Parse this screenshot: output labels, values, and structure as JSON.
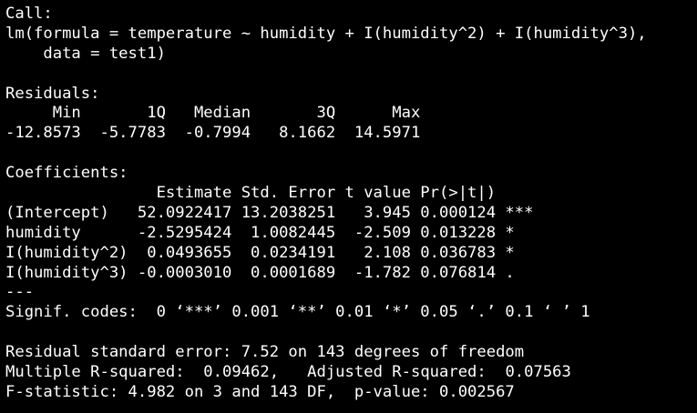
{
  "theme": {
    "background": "#000000",
    "foreground": "#ffffff"
  },
  "output": {
    "lines": [
      "Call:",
      "lm(formula = temperature ~ humidity + I(humidity^2) + I(humidity^3),",
      "    data = test1)",
      "",
      "Residuals:",
      "     Min       1Q   Median       3Q      Max ",
      "-12.8573  -5.7783  -0.7994   8.1662  14.5971 ",
      "",
      "Coefficients:",
      "                Estimate Std. Error t value Pr(>|t|)    ",
      "(Intercept)   52.0922417 13.2038251   3.945 0.000124 ***",
      "humidity      -2.5295424  1.0082445  -2.509 0.013228 *  ",
      "I(humidity^2)  0.0493655  0.0234191   2.108 0.036783 *  ",
      "I(humidity^3) -0.0003010  0.0001689  -1.782 0.076814 .  ",
      "---",
      "Signif. codes:  0 ‘***’ 0.001 ‘**’ 0.01 ‘*’ 0.05 ‘.’ 0.1 ‘ ’ 1",
      "",
      "Residual standard error: 7.52 on 143 degrees of freedom",
      "Multiple R-squared:  0.09462,\tAdjusted R-squared:  0.07563 ",
      "F-statistic: 4.982 on 3 and 143 DF,  p-value: 0.002567"
    ]
  }
}
